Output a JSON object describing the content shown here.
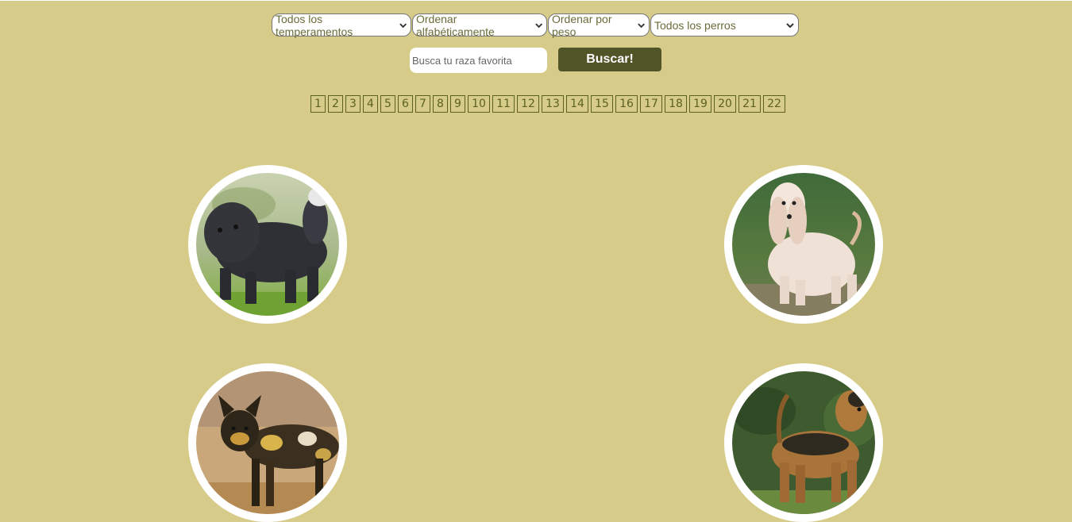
{
  "filters": {
    "temperaments": {
      "selected": "Todos los temperamentos"
    },
    "alphabetical": {
      "selected": "Ordenar alfabéticamente"
    },
    "weight": {
      "selected": "Ordenar por peso"
    },
    "source": {
      "selected": "Todos los perros"
    }
  },
  "search": {
    "placeholder": "Busca tu raza favorita",
    "value": "",
    "button_label": "Buscar!"
  },
  "pagination": {
    "pages": [
      "1",
      "2",
      "3",
      "4",
      "5",
      "6",
      "7",
      "8",
      "9",
      "10",
      "11",
      "12",
      "13",
      "14",
      "15",
      "16",
      "17",
      "18",
      "19",
      "20",
      "21",
      "22"
    ]
  },
  "dogs": [
    {
      "image": "black-shaggy-dog-photo"
    },
    {
      "image": "cream-long-haired-dog-photo"
    },
    {
      "image": "spotted-wild-dog-photo"
    },
    {
      "image": "tan-wiry-terrier-photo"
    }
  ],
  "colors": {
    "background": "#d7cb89",
    "accent": "#515426",
    "page_border": "#5c6020"
  }
}
